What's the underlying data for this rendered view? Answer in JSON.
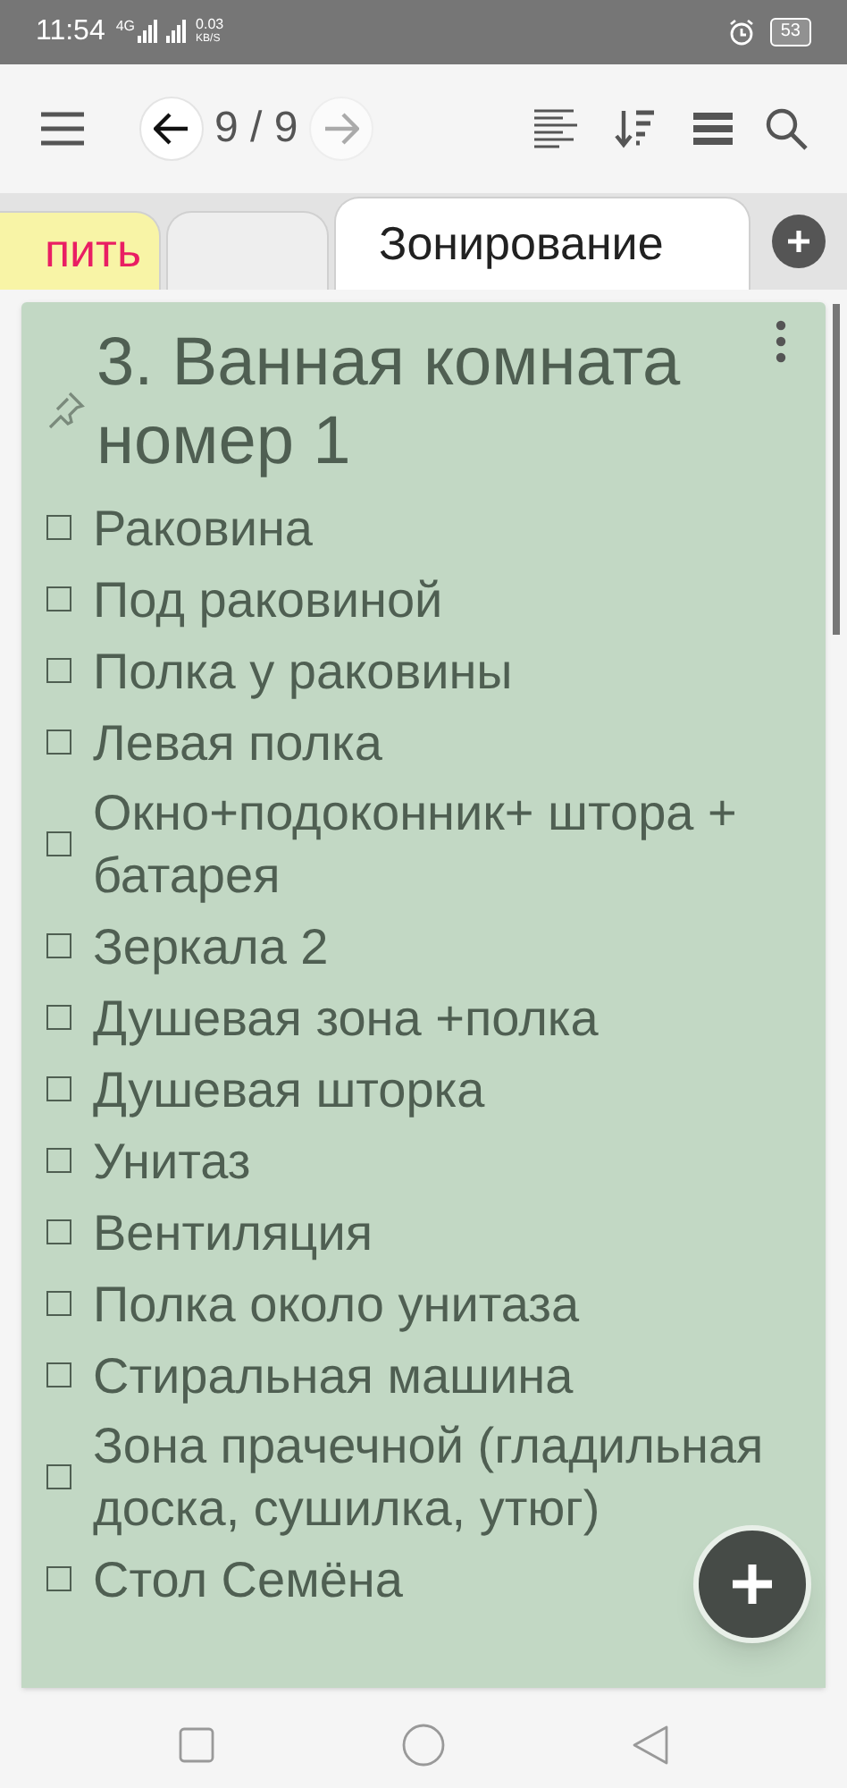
{
  "status_bar": {
    "time": "11:54",
    "network": "4G",
    "speed": "0.03",
    "speed_unit": "KB/S",
    "battery": "53"
  },
  "toolbar": {
    "counter": "9 / 9",
    "back": {
      "disabled": false
    },
    "forward": {
      "disabled": true
    }
  },
  "tabs": [
    {
      "label": "пить",
      "color": "#f8f4a6",
      "accent": true,
      "selected": false
    },
    {
      "color": "#eeeeee",
      "selected": false
    },
    {
      "label": "Зонирование",
      "color": "#ffffff",
      "accent": false,
      "selected": true
    }
  ],
  "note": {
    "title": "3. Ванная комната номер 1",
    "pinned": true,
    "color": "#c2d8c4",
    "items": [
      {
        "text": "Раковина",
        "checked": false
      },
      {
        "text": "Под раковиной",
        "checked": false
      },
      {
        "text": "Полка у раковины",
        "checked": false
      },
      {
        "text": "Левая полка",
        "checked": false
      },
      {
        "text": "Окно+подоконник+ штора + батарея",
        "checked": false
      },
      {
        "text": "Зеркала 2",
        "checked": false
      },
      {
        "text": "Душевая зона +полка",
        "checked": false
      },
      {
        "text": "Душевая шторка",
        "checked": false
      },
      {
        "text": "Унитаз",
        "checked": false
      },
      {
        "text": "Вентиляция",
        "checked": false
      },
      {
        "text": "Полка около унитаза",
        "checked": false
      },
      {
        "text": "Стиральная машина",
        "checked": false
      },
      {
        "text": "Зона прачечной (гладильная доска, сушилка, утюг)",
        "checked": false
      },
      {
        "text": "Стол Семёна",
        "checked": false
      }
    ]
  }
}
